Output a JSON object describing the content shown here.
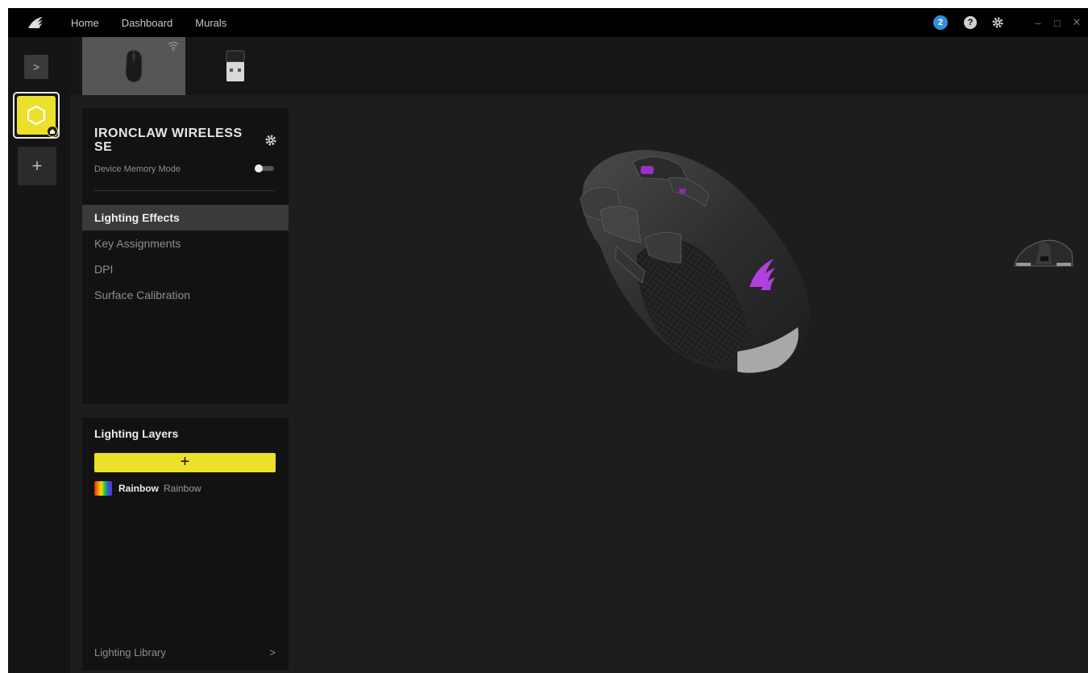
{
  "titlebar": {
    "nav": [
      "Home",
      "Dashboard",
      "Murals"
    ],
    "notification_count": "2",
    "help_glyph": "?",
    "window_controls": [
      "–",
      "□",
      "✕"
    ]
  },
  "rail": {
    "expand_glyph": ">",
    "add_glyph": "+"
  },
  "device": {
    "name": "IRONCLAW WIRELESS SE",
    "memory_mode_label": "Device Memory Mode",
    "memory_mode_on": false
  },
  "menu": {
    "items": [
      "Lighting Effects",
      "Key Assignments",
      "DPI",
      "Surface Calibration"
    ],
    "active_index": 0
  },
  "layers": {
    "title": "Lighting Layers",
    "add_glyph": "+",
    "items": [
      {
        "name": "Rainbow",
        "effect": "Rainbow"
      }
    ],
    "library_label": "Lighting Library",
    "library_arrow": ">"
  },
  "colors": {
    "accent": "#ece02a",
    "notification": "#2f8fe0",
    "logo_glow": "#b040e0"
  },
  "icons": [
    "corsair-logo-icon",
    "gear-icon",
    "help-icon",
    "wifi-icon",
    "chevron-right-icon",
    "plus-icon",
    "hexagon-profile-icon"
  ]
}
